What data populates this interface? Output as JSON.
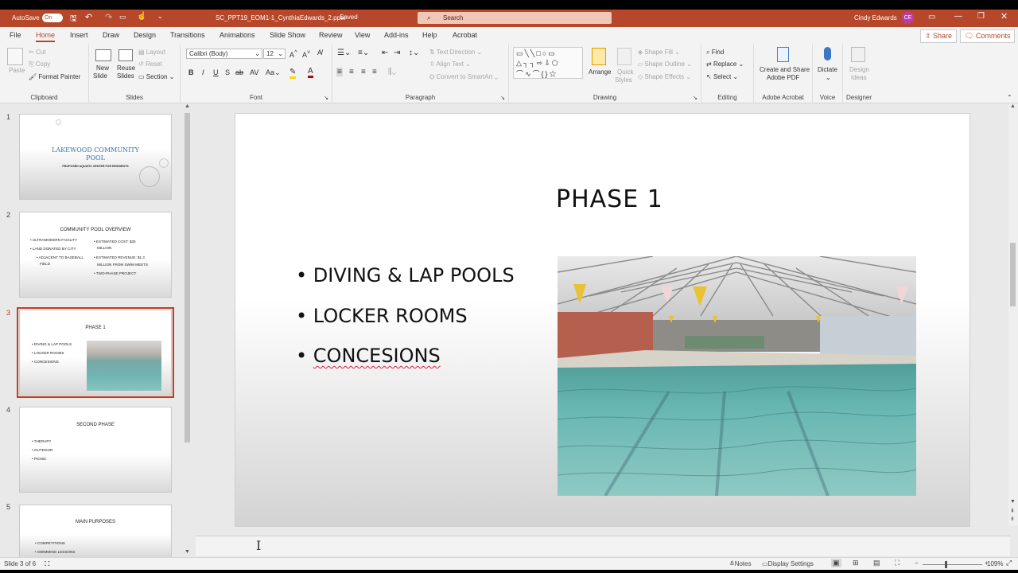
{
  "titlebar": {
    "autosave": "AutoSave",
    "toggle": "On",
    "filename": "SC_PPT19_EOM1-1_CynthiaEdwards_2.pptx",
    "saved": "Saved",
    "search": "Search",
    "user": "Cindy Edwards",
    "initials": "CE"
  },
  "menu": {
    "tabs": [
      "File",
      "Home",
      "Insert",
      "Draw",
      "Design",
      "Transitions",
      "Animations",
      "Slide Show",
      "Review",
      "View",
      "Add-ins",
      "Help",
      "Acrobat"
    ],
    "share": "Share",
    "comments": "Comments"
  },
  "ribbon": {
    "clipboard": {
      "paste": "Paste",
      "cut": "Cut",
      "copy": "Copy",
      "format_painter": "Format Painter",
      "label": "Clipboard"
    },
    "slides": {
      "new": "New",
      "new2": "Slide",
      "reuse": "Reuse",
      "reuse2": "Slides",
      "layout": "Layout",
      "reset": "Reset",
      "section": "Section",
      "label": "Slides"
    },
    "font": {
      "name": "Calibri (Body)",
      "size": "12",
      "label": "Font",
      "aa": "Aa"
    },
    "paragraph": {
      "text_direction": "Text Direction",
      "align_text": "Align Text",
      "smartart": "Convert to SmartArt",
      "label": "Paragraph"
    },
    "drawing": {
      "arrange": "Arrange",
      "quick": "Quick",
      "styles": "Styles",
      "fill": "Shape Fill",
      "outline": "Shape Outline",
      "effects": "Shape Effects",
      "label": "Drawing"
    },
    "editing": {
      "find": "Find",
      "replace": "Replace",
      "select": "Select",
      "label": "Editing"
    },
    "acrobat": {
      "line1": "Create and Share",
      "line2": "Adobe PDF",
      "label": "Adobe Acrobat"
    },
    "voice": {
      "dictate": "Dictate",
      "label": "Voice"
    },
    "designer": {
      "line1": "Design",
      "line2": "Ideas",
      "label": "Designer"
    }
  },
  "thumbnails": [
    {
      "num": "1",
      "title": "LAKEWOOD COMMUNITY POOL",
      "subtitle": "PROPOSED AQUATIC CENTER FOR RESIDENTS"
    },
    {
      "num": "2",
      "title": "COMMUNITY POOL OVERVIEW",
      "left": [
        "• ULTRAMODERN FACILITY",
        "• LAND DONATED BY CITY",
        "• ADJACENT TO BASEBALL",
        "FIELD"
      ],
      "right": [
        "• ESTIMATED COST: $25",
        "MILLION",
        "• ESTIMATED REVENUE: $1.3",
        "MILLION FROM SWIM MEETS",
        "• TWO-PHASE PROJECT"
      ]
    },
    {
      "num": "3",
      "title": "PHASE 1",
      "bullets": [
        "• DIVING & LAP POOLS",
        "• LOCKER ROOMS",
        "• CONCESIONS"
      ]
    },
    {
      "num": "4",
      "title": "SECOND PHASE",
      "bullets": [
        "• THERAPY",
        "• OUTDOOR",
        "• PICNIC"
      ]
    },
    {
      "num": "5",
      "title": "MAIN PURPOSES",
      "bullets": [
        "• COMPETITIONS",
        "• SWIMMING LESSONS"
      ]
    }
  ],
  "slide": {
    "title": "PHASE 1",
    "bullets": [
      "DIVING & LAP POOLS",
      "LOCKER ROOMS",
      "CONCESIONS"
    ],
    "bullet_char": "•"
  },
  "status": {
    "slide_info": "Slide 3 of 6",
    "notes": "Notes",
    "display": "Display Settings",
    "zoom": "109%"
  },
  "colors": {
    "accent": "#b7472a",
    "selection": "#c43e1c",
    "title_blue": "#2e74b5"
  }
}
